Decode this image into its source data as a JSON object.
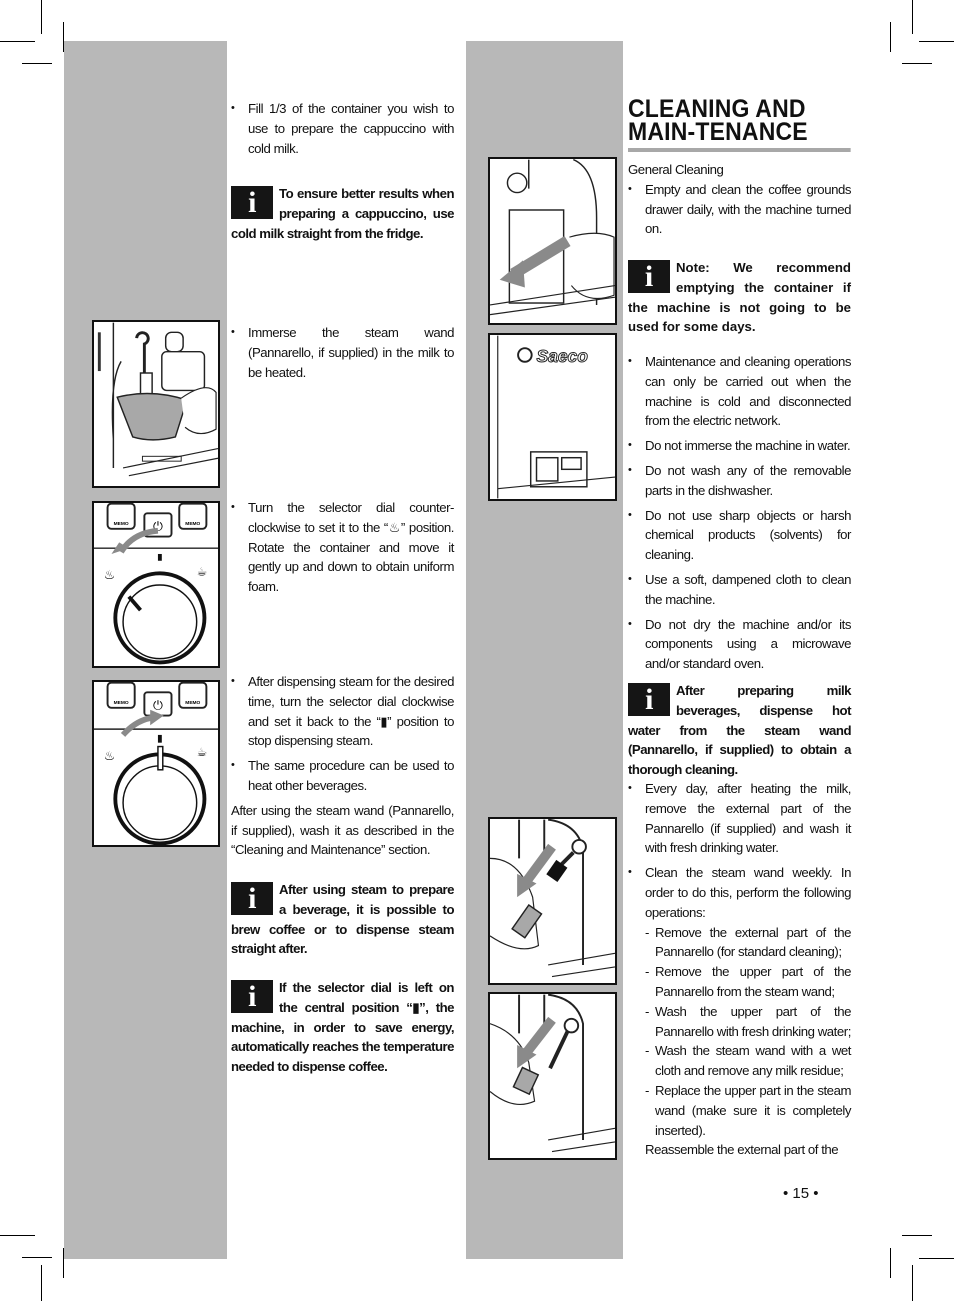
{
  "left_column": {
    "intro_bullet": "Fill 1/3 of the container you wish to use to prepare the cappuccino with cold milk.",
    "info_1": "To ensure better results when preparing a cappuccino, use cold milk straight from the fridge.",
    "step_immerse": "Immerse the steam wand (Pannarello, if supplied) in the milk to be heated.",
    "step_turn": "Turn the selector dial counter-clockwise to set it to the “♨” position. Rotate the container and move it gently up and down to obtain uniform foam.",
    "step_after": "After dispensing steam for the desired time, turn the selector dial clockwise and set it back to the “▮” position to stop dispensing steam.",
    "step_same": "The same procedure can be used to heat other beverages.",
    "after_paragraph": "After using the steam wand (Pannarello, if supplied), wash it as described in the “Cleaning and Maintenance” section.",
    "info_2": "After using steam to prepare a beverage, it is possible to brew coffee or to dispense steam straight after.",
    "info_3": "If the selector dial is left on the central position “▮”, the machine, in order to save energy, automatically reaches the temperature needed to dispense coffee."
  },
  "right_column": {
    "title": "CLEANING AND MAIN-TENANCE",
    "subtitle": "General Cleaning",
    "bullet_grounds": "Empty and clean the coffee grounds drawer daily, with the machine turned on.",
    "info_note": "Note: We recommend emptying the container if the machine is not going to be used for some days.",
    "bullets": [
      "Maintenance and cleaning operations can only be carried out when the machine is cold and disconnected from the electric network.",
      "Do not immerse the machine in water.",
      "Do not wash any of the removable parts in the dishwasher.",
      "Do not use sharp objects or harsh chemical products (solvents) for cleaning.",
      "Use a soft, dampened cloth to clean the machine.",
      "Do not dry the machine and/or its components using a microwave and/or standard oven."
    ],
    "info_milk": "After preparing milk beverages, dispense hot water from the steam wand (Pannarello, if supplied) to obtain a thorough cleaning.",
    "bullet_everyday": "Every day, after heating the milk, remove the external part of the Pannarello (if supplied) and wash it with fresh drinking water.",
    "bullet_weekly": "Clean the steam wand weekly. In order to do this, perform the following operations:",
    "weekly_steps": [
      "Remove the external part of the Pannarello (for standard cleaning);",
      "Remove the upper part of the Pannarello from the steam wand;",
      "Wash the upper part of the Pannarello with fresh drinking water;",
      "Wash the steam wand with a wet cloth and remove any milk residue;",
      "Replace the upper part in the steam wand (make sure it is completely inserted)."
    ],
    "reassemble": "Reassemble the external part of the"
  },
  "figures": {
    "memo_label": "MEMO",
    "brand_label": "Saeco",
    "info_icon_glyph": "i"
  },
  "footer": {
    "page_number": "• 15 •"
  },
  "colors": {
    "gray_band": "#b8b8b8",
    "title_rule": "#a8a8a8",
    "info_box": "#151515"
  }
}
